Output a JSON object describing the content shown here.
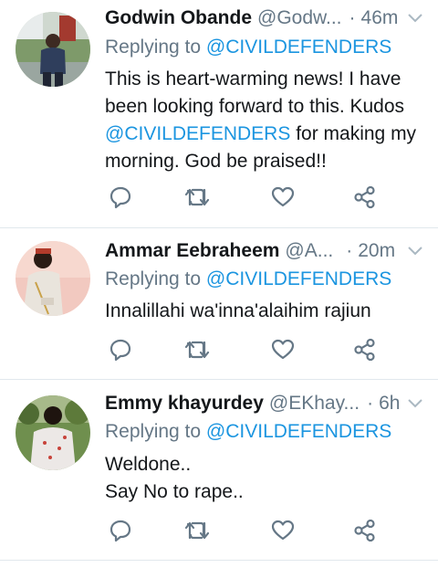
{
  "colors": {
    "text": "#14171a",
    "muted": "#657786",
    "link": "#1b95e0",
    "divider": "#e1e8ed"
  },
  "icons": [
    "chevron-down-icon",
    "reply-icon",
    "retweet-icon",
    "like-icon",
    "share-icon"
  ],
  "tweets": [
    {
      "name": "Godwin Obande",
      "handle": "@Godw...",
      "dot": "·",
      "time": "46m",
      "replying_prefix": "Replying to ",
      "replying_to": "@CIVILDEFENDERS",
      "text_line1": "This is heart-warming news! I have",
      "text_line2": "been looking forward to this. Kudos",
      "text_mention": "@CIVILDEFENDERS",
      "text_line3_rest": " for making my",
      "text_line4": "morning. God be praised!!"
    },
    {
      "name": "Ammar Eebraheem",
      "handle": "@A...",
      "dot": "·",
      "time": "20m",
      "replying_prefix": "Replying to ",
      "replying_to": "@CIVILDEFENDERS",
      "text_line1": "Innalillahi wa'inna'alaihim rajiun"
    },
    {
      "name": "Emmy khayurdey",
      "handle": "@EKhay...",
      "dot": "·",
      "time": "6h",
      "replying_prefix": "Replying to ",
      "replying_to": "@CIVILDEFENDERS",
      "text_line1": "Weldone..",
      "text_line2": "Say No to rape.."
    }
  ]
}
